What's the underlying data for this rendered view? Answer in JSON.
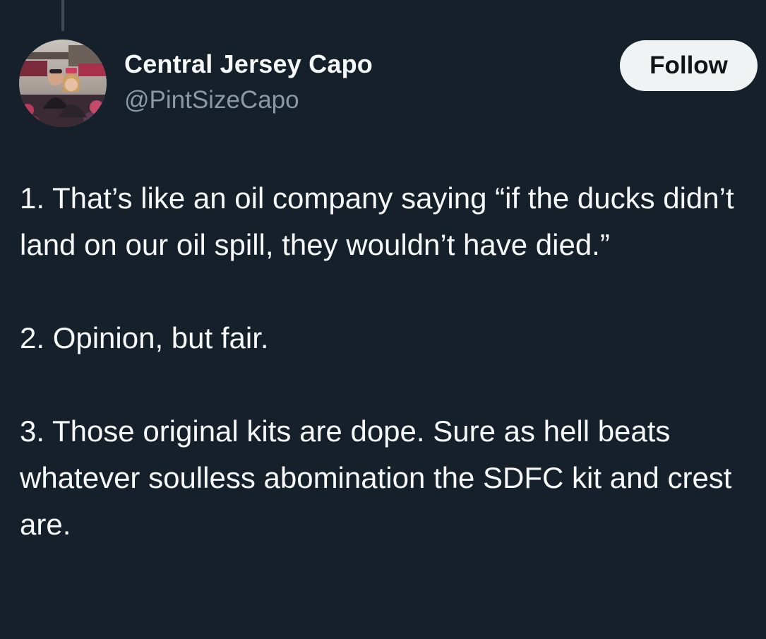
{
  "colors": {
    "background": "#15202b",
    "text_primary": "#f7f9f9",
    "text_secondary": "#8b98a5",
    "follow_button_bg": "#eff3f4",
    "follow_button_text": "#0f1419",
    "thread_line": "#3e4a56"
  },
  "author": {
    "avatar": "profile-photo",
    "display_name": "Central Jersey Capo",
    "handle": "@PintSizeCapo"
  },
  "actions": {
    "follow_label": "Follow"
  },
  "tweet": {
    "paragraphs": [
      "1. That’s like an oil company saying “if the ducks didn’t land on our oil spill, they wouldn’t have died.”",
      "2. Opinion, but fair.",
      "3. Those original kits are dope. Sure as hell beats whatever soulless abomination the SDFC kit and crest are."
    ]
  }
}
